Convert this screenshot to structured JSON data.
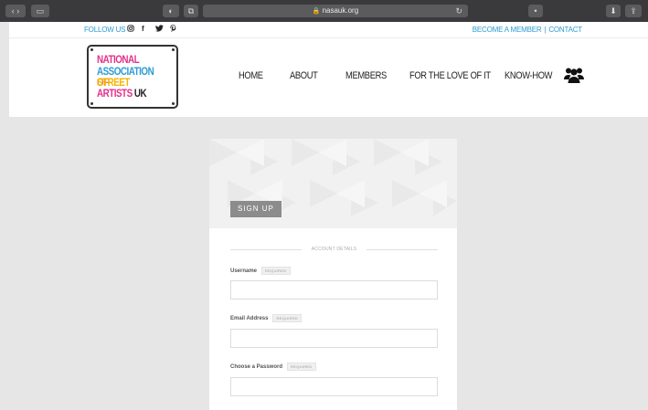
{
  "browser": {
    "url": "nasauk.org",
    "colors": {
      "toolbar": "#3a3a3c"
    }
  },
  "topstrip": {
    "follow_label": "FOLLOW US",
    "social_icons": [
      "instagram-icon",
      "facebook-icon",
      "twitter-icon",
      "pinterest-icon"
    ],
    "become_member": "BECOME A MEMBER",
    "separator": "|",
    "contact": "CONTACT"
  },
  "logo": {
    "lines": [
      "NATIONAL",
      "ASSOCIATION OF",
      "STREET",
      "ARTISTS UK"
    ]
  },
  "nav": {
    "items": [
      "HOME",
      "ABOUT",
      "MEMBERS",
      "FOR THE LOVE OF IT",
      "KNOW-HOW"
    ],
    "account_icon": "users-icon"
  },
  "signup": {
    "button_label": "SIGN UP",
    "section_label": "ACCOUNT DETAILS",
    "required_label": "REQUIRED",
    "fields": [
      {
        "label": "Username",
        "value": ""
      },
      {
        "label": "Email Address",
        "value": ""
      },
      {
        "label": "Choose a Password",
        "value": ""
      }
    ]
  },
  "colors": {
    "link_blue": "#2b9bd3",
    "page_bg": "#e6e6e6",
    "signup_btn": "#8c8c8c"
  }
}
